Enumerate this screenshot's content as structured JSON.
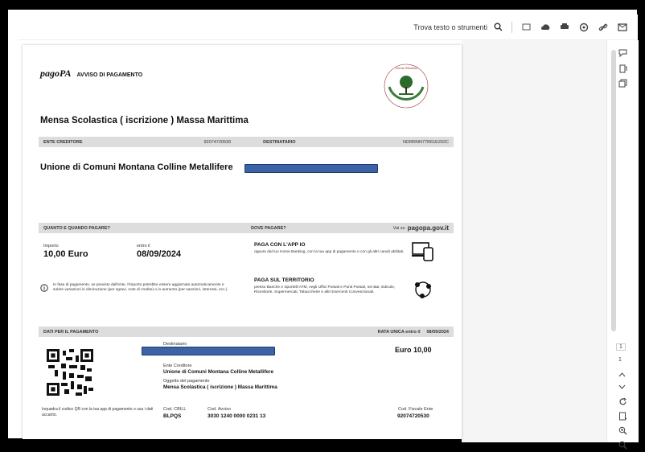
{
  "toolbar": {
    "find_label": "Trova testo o strumenti"
  },
  "document": {
    "brand": "pagoPA",
    "notice_label": "AVVISO DI PAGAMENTO",
    "seal_text": "Unione Montana Colline Metallifere",
    "title": "Mensa Scolastica ( iscrizione ) Massa Marittima",
    "creditor_header": "ENTE CREDITORE",
    "creditor_code": "92074720530",
    "recipient_header": "DESTINATARIO",
    "recipient_code": "NDRRNN77R61E202C",
    "creditor_name": "Unione di Comuni Montana Colline Metallifere",
    "how_much_header": "QUANTO E QUANDO PAGARE?",
    "where_header": "DOVE PAGARE?",
    "where_via": "Vai su",
    "where_site": "pagopa.gov.it",
    "amount_label": "Importo",
    "amount_value": "10,00 Euro",
    "due_label": "entro il",
    "due_value": "08/09/2024",
    "app_title": "PAGA CON L'APP IO",
    "app_text": "oppure dal tuo Home Banking, con la tua app di pagamento o con gli altri canali abilitati.",
    "info_text": "In fase di pagamento, se previsto dall'ente, l'importo potrebbe essere aggiornato automaticamente e subire variazioni in diminuzione (per sgravi, note di credito) o in aumento (per sanzioni, interessi, ecc.)",
    "territory_title": "PAGA SUL TERRITORIO",
    "territory_text": "presso Banche e Sportelli ATM, negli Uffici Postali e Punti Postali, nei Bar, Edicole, Ricevitorie, Supermercati, Tabaccherie e altri Esercenti Convenzionati.",
    "payment_data_header": "DATI PER IL PAGAMENTO",
    "single_installment": "RATA UNICA entro il",
    "single_date": "08/09/2024",
    "recipient_field": "Destinatario",
    "euro_total": "Euro 10,00",
    "creditor_field": "Ente Creditore",
    "creditor_field_value": "Unione di Comuni Montana Colline Metallifere",
    "object_field": "Oggetto del pagamento",
    "object_field_value": "Mensa Scolastica ( iscrizione ) Massa Marittima",
    "qr_hint": "Inquadra il codice QR con la tua app di pagamento o usa i dati accanto.",
    "cbill_label": "Cod. CBILL",
    "cbill_value": "BLPQS",
    "notice_code_label": "Cod. Avviso",
    "notice_code_value": "3030 1240 0000 0231 13",
    "tax_code_label": "Cod. Fiscale Ente",
    "tax_code_value": "92074720530"
  },
  "sidebar": {
    "page_number": "1",
    "page_total": "1"
  }
}
